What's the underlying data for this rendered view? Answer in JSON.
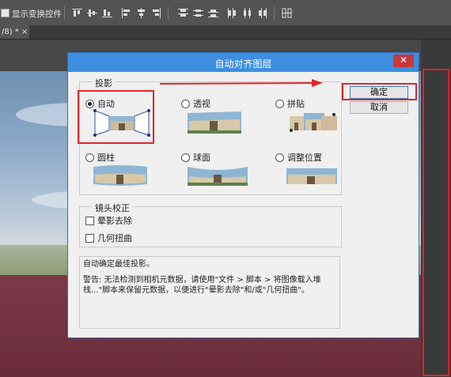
{
  "options_bar": {
    "show_transform_controls_label": "显示变换控件",
    "align_icons": [
      "align-top-edges-icon",
      "align-vertical-centers-icon",
      "align-bottom-edges-icon",
      "align-left-edges-icon",
      "align-horizontal-centers-icon",
      "align-right-edges-icon",
      "distribute-top-icon",
      "distribute-vcenter-icon",
      "distribute-bottom-icon",
      "distribute-left-icon",
      "distribute-hcenter-icon",
      "distribute-right-icon",
      "auto-align-icon"
    ]
  },
  "document_tab": {
    "label": "/8) *",
    "close": "×"
  },
  "dialog": {
    "title": "自动对齐图层",
    "close_symbol": "✕",
    "projection": {
      "group_label": "投影",
      "options": [
        {
          "label": "自动",
          "selected": true
        },
        {
          "label": "透视",
          "selected": false
        },
        {
          "label": "拼贴",
          "selected": false
        },
        {
          "label": "圆柱",
          "selected": false
        },
        {
          "label": "球面",
          "selected": false
        },
        {
          "label": "调整位置",
          "selected": false
        }
      ]
    },
    "lens": {
      "group_label": "镜头校正",
      "vignette_label": "晕影去除",
      "distortion_label": "几何扭曲"
    },
    "buttons": {
      "ok": "确定",
      "cancel": "取消"
    },
    "message": {
      "line1": "自动确定最佳投影。",
      "line2": "警告: 无法检测到相机元数据，请使用\"文件 > 脚本 > 将图像载入堆栈...\"脚本来保留元数据，以便进行\"晕影去除\"和/或\"几何扭曲\"。"
    }
  },
  "colors": {
    "accent": "#3d8ee0",
    "highlight": "#e0252b"
  }
}
